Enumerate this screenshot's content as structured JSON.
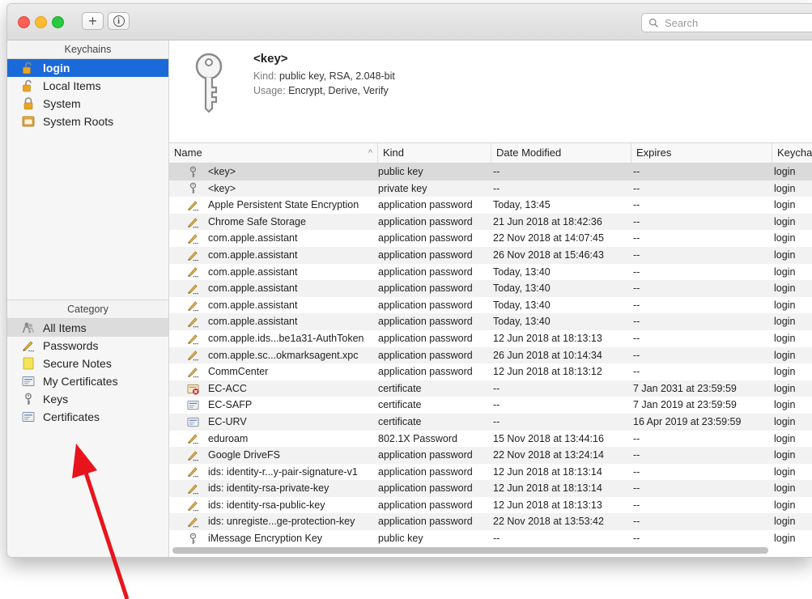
{
  "colors": {
    "accent": "#1b6ad9",
    "close": "#fe5f57",
    "minimize": "#febc2e",
    "zoom": "#28c840",
    "arrow": "#e8141c"
  },
  "toolbar": {
    "add_label": "+",
    "info_label": "i"
  },
  "search": {
    "placeholder": "Search"
  },
  "keychains": {
    "header": "Keychains",
    "items": [
      {
        "label": "login",
        "icon": "lock-open-icon",
        "selected": true
      },
      {
        "label": "Local Items",
        "icon": "lock-open-icon"
      },
      {
        "label": "System",
        "icon": "lock-closed-icon"
      },
      {
        "label": "System Roots",
        "icon": "cabinet-icon"
      }
    ]
  },
  "category": {
    "header": "Category",
    "items": [
      {
        "label": "All Items",
        "icon": "people-icon",
        "highlighted": true
      },
      {
        "label": "Passwords",
        "icon": "pencil-icon"
      },
      {
        "label": "Secure Notes",
        "icon": "note-icon"
      },
      {
        "label": "My Certificates",
        "icon": "certificate-icon"
      },
      {
        "label": "Keys",
        "icon": "key-icon"
      },
      {
        "label": "Certificates",
        "icon": "certificate-icon"
      }
    ]
  },
  "detail": {
    "name": "<key>",
    "kind_label": "Kind:",
    "kind_value": "public key, RSA, 2.048-bit",
    "usage_label": "Usage:",
    "usage_value": "Encrypt, Derive, Verify",
    "icon": "key-large-icon"
  },
  "table": {
    "columns": [
      "Name",
      "Kind",
      "Date Modified",
      "Expires",
      "Keycha"
    ],
    "sort_indicator": "^",
    "rows": [
      {
        "icon": "key-icon",
        "name": "<key>",
        "kind": "public key",
        "date": "--",
        "expires": "--",
        "keychain": "login",
        "selected": true
      },
      {
        "icon": "key-icon",
        "name": "<key>",
        "kind": "private key",
        "date": "--",
        "expires": "--",
        "keychain": "login"
      },
      {
        "icon": "password-icon",
        "name": "Apple Persistent State Encryption",
        "kind": "application password",
        "date": "Today, 13:45",
        "expires": "--",
        "keychain": "login"
      },
      {
        "icon": "password-icon",
        "name": "Chrome Safe Storage",
        "kind": "application password",
        "date": "21 Jun 2018 at 18:42:36",
        "expires": "--",
        "keychain": "login"
      },
      {
        "icon": "password-icon",
        "name": "com.apple.assistant",
        "kind": "application password",
        "date": "22 Nov 2018 at 14:07:45",
        "expires": "--",
        "keychain": "login"
      },
      {
        "icon": "password-icon",
        "name": "com.apple.assistant",
        "kind": "application password",
        "date": "26 Nov 2018 at 15:46:43",
        "expires": "--",
        "keychain": "login"
      },
      {
        "icon": "password-icon",
        "name": "com.apple.assistant",
        "kind": "application password",
        "date": "Today, 13:40",
        "expires": "--",
        "keychain": "login"
      },
      {
        "icon": "password-icon",
        "name": "com.apple.assistant",
        "kind": "application password",
        "date": "Today, 13:40",
        "expires": "--",
        "keychain": "login"
      },
      {
        "icon": "password-icon",
        "name": "com.apple.assistant",
        "kind": "application password",
        "date": "Today, 13:40",
        "expires": "--",
        "keychain": "login"
      },
      {
        "icon": "password-icon",
        "name": "com.apple.assistant",
        "kind": "application password",
        "date": "Today, 13:40",
        "expires": "--",
        "keychain": "login"
      },
      {
        "icon": "password-icon",
        "name": "com.apple.ids...be1a31-AuthToken",
        "kind": "application password",
        "date": "12 Jun 2018 at 18:13:13",
        "expires": "--",
        "keychain": "login"
      },
      {
        "icon": "password-icon",
        "name": "com.apple.sc...okmarksagent.xpc",
        "kind": "application password",
        "date": "26 Jun 2018 at 10:14:34",
        "expires": "--",
        "keychain": "login"
      },
      {
        "icon": "password-icon",
        "name": "CommCenter",
        "kind": "application password",
        "date": "12 Jun 2018 at 18:13:12",
        "expires": "--",
        "keychain": "login"
      },
      {
        "icon": "certificate-invalid-icon",
        "name": "EC-ACC",
        "kind": "certificate",
        "date": "--",
        "expires": "7 Jan 2031 at 23:59:59",
        "keychain": "login"
      },
      {
        "icon": "certificate-icon",
        "name": "EC-SAFP",
        "kind": "certificate",
        "date": "--",
        "expires": "7 Jan 2019 at 23:59:59",
        "keychain": "login"
      },
      {
        "icon": "certificate-icon",
        "name": "EC-URV",
        "kind": "certificate",
        "date": "--",
        "expires": "16 Apr 2019 at 23:59:59",
        "keychain": "login"
      },
      {
        "icon": "password-icon",
        "name": "eduroam",
        "kind": "802.1X Password",
        "date": "15 Nov 2018 at 13:44:16",
        "expires": "--",
        "keychain": "login"
      },
      {
        "icon": "password-icon",
        "name": "Google DriveFS",
        "kind": "application password",
        "date": "22 Nov 2018 at 13:24:14",
        "expires": "--",
        "keychain": "login"
      },
      {
        "icon": "password-icon",
        "name": "ids: identity-r...y-pair-signature-v1",
        "kind": "application password",
        "date": "12 Jun 2018 at 18:13:14",
        "expires": "--",
        "keychain": "login"
      },
      {
        "icon": "password-icon",
        "name": "ids: identity-rsa-private-key",
        "kind": "application password",
        "date": "12 Jun 2018 at 18:13:14",
        "expires": "--",
        "keychain": "login"
      },
      {
        "icon": "password-icon",
        "name": "ids: identity-rsa-public-key",
        "kind": "application password",
        "date": "12 Jun 2018 at 18:13:13",
        "expires": "--",
        "keychain": "login"
      },
      {
        "icon": "password-icon",
        "name": "ids: unregiste...ge-protection-key",
        "kind": "application password",
        "date": "22 Nov 2018 at 13:53:42",
        "expires": "--",
        "keychain": "login"
      },
      {
        "icon": "key-icon",
        "name": "iMessage Encryption Key",
        "kind": "public key",
        "date": "--",
        "expires": "--",
        "keychain": "login"
      }
    ]
  }
}
